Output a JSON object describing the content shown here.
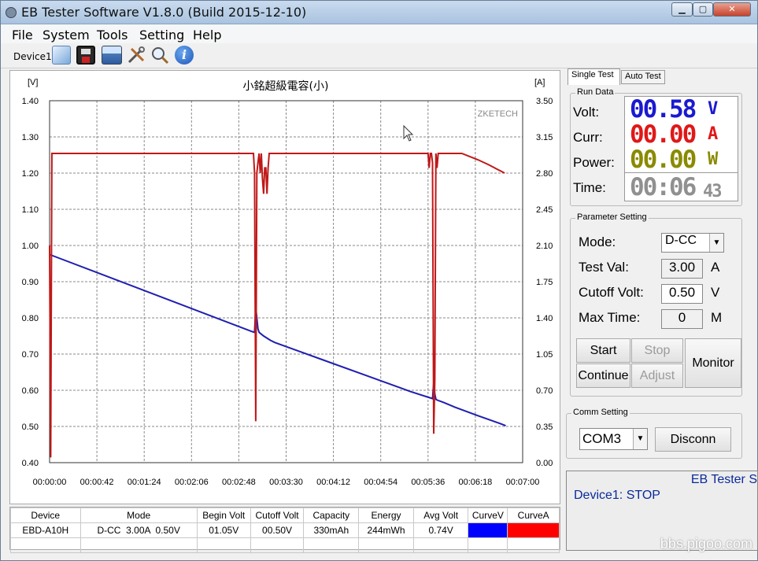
{
  "window": {
    "title": "EB Tester Software V1.8.0 (Build 2015-12-10)",
    "min": "▁",
    "max": "▢",
    "close": "✕"
  },
  "menu": [
    "File",
    "System",
    "Tools",
    "Setting",
    "Help"
  ],
  "toolbar": {
    "device": "Device1",
    "icons": [
      "open-folder-icon",
      "save-icon",
      "image-icon",
      "tools-icon",
      "zoom-icon",
      "info-icon"
    ]
  },
  "chart_data": {
    "type": "line",
    "title": "小銘超級電容(小)",
    "watermark": "ZKETECH",
    "left_unit": "[V]",
    "right_unit": "[A]",
    "ylim_left": [
      0.4,
      1.4
    ],
    "ylim_right": [
      0.0,
      3.5
    ],
    "yticks_left": [
      "1.40",
      "1.30",
      "1.20",
      "1.10",
      "1.00",
      "0.90",
      "0.80",
      "0.70",
      "0.60",
      "0.50",
      "0.40"
    ],
    "yticks_right": [
      "3.50",
      "3.15",
      "2.80",
      "2.45",
      "2.10",
      "1.75",
      "1.40",
      "1.05",
      "0.70",
      "0.35",
      "0.00"
    ],
    "xticks": [
      "00:00:00",
      "00:00:42",
      "00:01:24",
      "00:02:06",
      "00:02:48",
      "00:03:30",
      "00:04:12",
      "00:04:54",
      "00:05:36",
      "00:06:18",
      "00:07:00"
    ],
    "xlim": [
      0,
      420
    ],
    "series": [
      {
        "color": "#1f1fb0",
        "axis": "left",
        "x": [
          0,
          180,
          182,
          183,
          184,
          185,
          186,
          188,
          190,
          196,
          200,
          240,
          280,
          320,
          340,
          341,
          342,
          343,
          344,
          350,
          360,
          380,
          400,
          405
        ],
        "y": [
          0.975,
          0.762,
          0.76,
          0.83,
          0.8,
          0.77,
          0.76,
          0.755,
          0.75,
          0.738,
          0.732,
          0.687,
          0.642,
          0.597,
          0.577,
          0.62,
          0.59,
          0.575,
          0.573,
          0.566,
          0.553,
          0.53,
          0.508,
          0.502
        ]
      },
      {
        "color": "#c01818",
        "axis": "right",
        "x": [
          0,
          1,
          2,
          3,
          181,
          182,
          183,
          184,
          185,
          186,
          187,
          188,
          189,
          190,
          191,
          192,
          193,
          194,
          195,
          196,
          197,
          336,
          337,
          338,
          339,
          340,
          341,
          342,
          343,
          344,
          345,
          346,
          347,
          360,
          366,
          380,
          390,
          404
        ],
        "y": [
          2.1,
          0.05,
          2.99,
          2.99,
          2.99,
          2.8,
          0.4,
          2.8,
          2.9,
          2.99,
          2.8,
          2.99,
          2.75,
          2.6,
          2.85,
          2.85,
          2.6,
          2.85,
          2.99,
          2.99,
          2.99,
          2.99,
          2.85,
          2.99,
          2.99,
          2.9,
          0.28,
          0.8,
          2.99,
          2.85,
          2.99,
          2.99,
          2.99,
          2.99,
          2.99,
          2.93,
          2.88,
          2.8
        ]
      }
    ]
  },
  "table": {
    "headers": [
      "Device",
      "Mode",
      "Begin Volt",
      "Cutoff Volt",
      "Capacity",
      "Energy",
      "Avg Volt",
      "CurveV",
      "CurveA"
    ],
    "row": [
      "EBD-A10H",
      "D-CC  3.00A  0.50V",
      "01.05V",
      "00.50V",
      "330mAh",
      "244mWh",
      "0.74V",
      "",
      ""
    ],
    "curve_colors": [
      "#0000ff",
      "#ff0000"
    ]
  },
  "tabs": [
    "Single Test",
    "Auto Test"
  ],
  "run": {
    "title": "Run Data",
    "volt_label": "Volt:",
    "curr_label": "Curr:",
    "power_label": "Power:",
    "time_label": "Time:",
    "volt": "00.58",
    "volt_unit": "V",
    "curr": "00.00",
    "curr_unit": "A",
    "power": "00.00",
    "power_unit": "W",
    "time": "00:06",
    "time_sec": "43",
    "volt_color": "#1a1ad0",
    "curr_color": "#e01818",
    "power_color": "#8a8a00",
    "time_color": "#909090"
  },
  "param": {
    "title": "Parameter Setting",
    "mode_label": "Mode:",
    "mode": "D-CC",
    "testval_label": "Test Val:",
    "testval": "3.00",
    "testval_unit": "A",
    "cutoff_label": "Cutoff Volt:",
    "cutoff": "0.50",
    "cutoff_unit": "V",
    "maxtime_label": "Max Time:",
    "maxtime": "0",
    "maxtime_unit": "M"
  },
  "buttons": {
    "start": "Start",
    "stop": "Stop",
    "continue": "Continue",
    "adjust": "Adjust",
    "monitor": "Monitor"
  },
  "comm": {
    "title": "Comm Setting",
    "port": "COM3",
    "disconn": "Disconn"
  },
  "status": {
    "line1": "EB Tester S",
    "line2": "Device1: STOP"
  },
  "watermark_site": "bbs.pigoo.com"
}
